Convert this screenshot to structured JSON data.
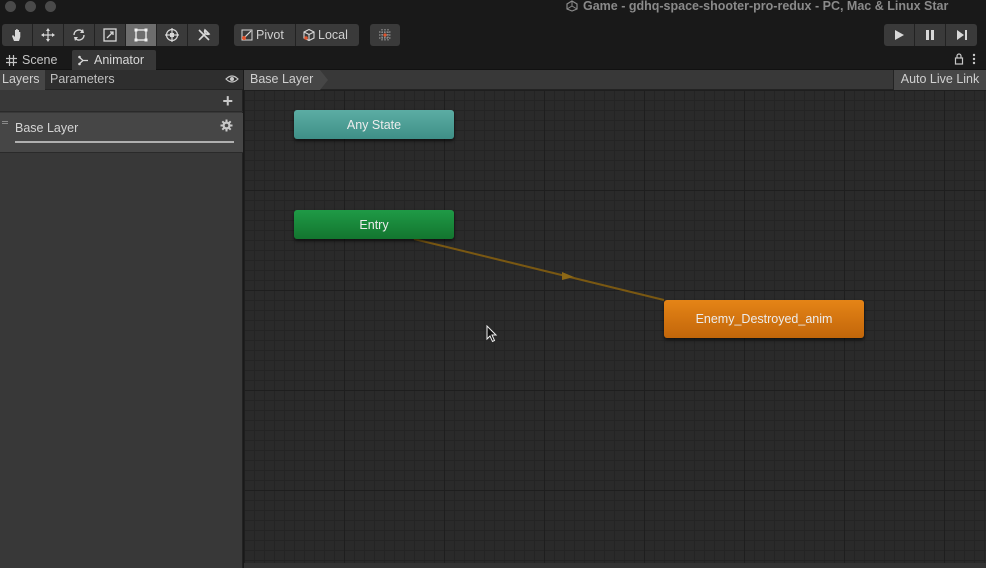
{
  "window": {
    "title": "Game - gdhq-space-shooter-pro-redux - PC, Mac & Linux Star"
  },
  "toolbar": {
    "tools": [
      "hand-tool",
      "move-tool",
      "rotate-tool",
      "scale-tool",
      "rect-tool",
      "transform-tool",
      "custom-tool"
    ],
    "active_tool": "rect-tool",
    "pivot_label": "Pivot",
    "local_label": "Local"
  },
  "tabs": {
    "scene_label": "Scene",
    "animator_label": "Animator"
  },
  "left_panel": {
    "layers_tab": "Layers",
    "parameters_tab": "Parameters",
    "layer_name": "Base Layer"
  },
  "graph": {
    "breadcrumb": "Base Layer",
    "auto_live_link": "Auto Live Link",
    "states": {
      "any_state": "Any State",
      "entry": "Entry",
      "enemy_destroyed": "Enemy_Destroyed_anim"
    }
  },
  "colors": {
    "any_state": "#4f9f97",
    "entry": "#18893b",
    "default_state": "#d8760f",
    "transition": "#7a5812"
  }
}
